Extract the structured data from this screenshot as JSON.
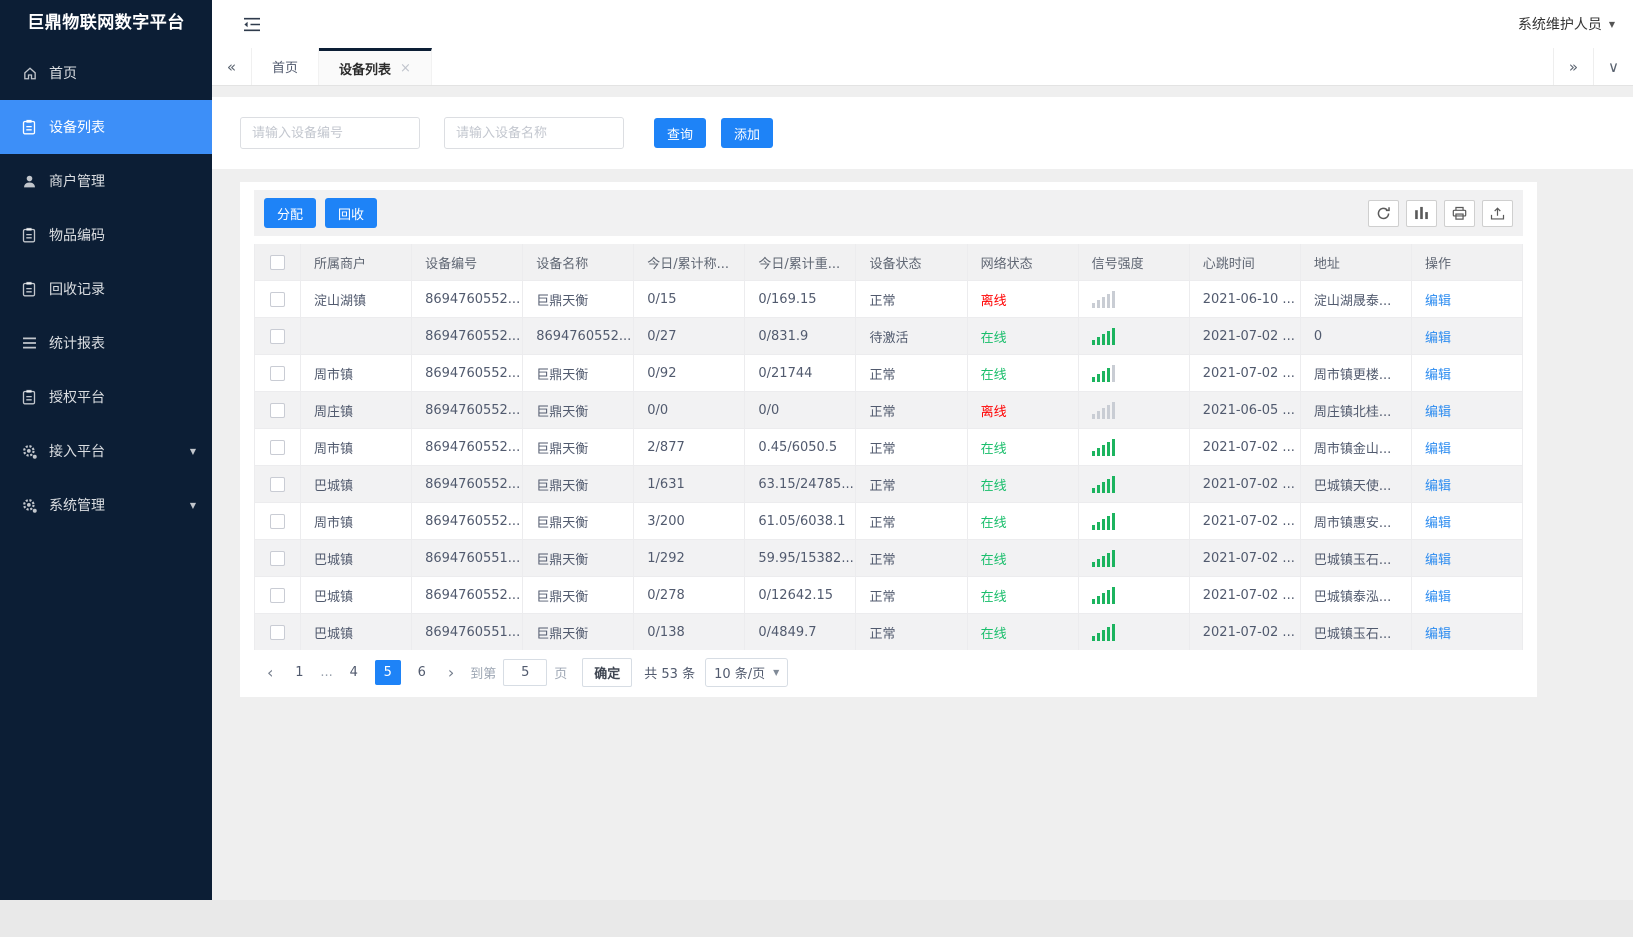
{
  "app": {
    "title": "巨鼎物联网数字平台",
    "user_name": "系统维护人员"
  },
  "sidebar": {
    "items": [
      {
        "label": "首页",
        "icon": "home-icon",
        "active": false,
        "caret": false
      },
      {
        "label": "设备列表",
        "icon": "device-list-icon",
        "active": true,
        "caret": false
      },
      {
        "label": "商户管理",
        "icon": "merchant-icon",
        "active": false,
        "caret": false
      },
      {
        "label": "物品编码",
        "icon": "item-code-icon",
        "active": false,
        "caret": false
      },
      {
        "label": "回收记录",
        "icon": "recycle-record-icon",
        "active": false,
        "caret": false
      },
      {
        "label": "统计报表",
        "icon": "report-icon",
        "active": false,
        "caret": false
      },
      {
        "label": "授权平台",
        "icon": "auth-platform-icon",
        "active": false,
        "caret": false
      },
      {
        "label": "接入平台",
        "icon": "access-platform-icon",
        "active": false,
        "caret": true
      },
      {
        "label": "系统管理",
        "icon": "system-manage-icon",
        "active": false,
        "caret": true
      }
    ]
  },
  "tabbar": {
    "tabs": [
      {
        "label": "首页",
        "active": false,
        "closable": false
      },
      {
        "label": "设备列表",
        "active": true,
        "closable": true
      }
    ]
  },
  "search": {
    "device_no_placeholder": "请输入设备编号",
    "device_name_placeholder": "请输入设备名称",
    "query_label": "查询",
    "add_label": "添加"
  },
  "toolbar": {
    "assign_label": "分配",
    "recycle_label": "回收",
    "icons": [
      "refresh-icon",
      "columns-icon",
      "print-icon",
      "export-icon"
    ]
  },
  "table": {
    "columns": [
      "所属商户",
      "设备编号",
      "设备名称",
      "今日/累计称...",
      "今日/累计重...",
      "设备状态",
      "网络状态",
      "信号强度",
      "心跳时间",
      "地址",
      "操作"
    ],
    "edit_label": "编辑",
    "rows": [
      {
        "merchant": "淀山湖镇",
        "device_no": "8694760552...",
        "device_name": "巨鼎天衡",
        "today_count": "0/15",
        "today_weight": "0/169.15",
        "device_status": "正常",
        "network_status": "离线",
        "online": false,
        "signal": 0,
        "heartbeat": "2021-06-10 ...",
        "address": "淀山湖晟泰..."
      },
      {
        "merchant": "",
        "device_no": "8694760552...",
        "device_name": "8694760552...",
        "today_count": "0/27",
        "today_weight": "0/831.9",
        "device_status": "待激活",
        "network_status": "在线",
        "online": true,
        "signal": 5,
        "heartbeat": "2021-07-02 ...",
        "address": "0"
      },
      {
        "merchant": "周市镇",
        "device_no": "8694760552...",
        "device_name": "巨鼎天衡",
        "today_count": "0/92",
        "today_weight": "0/21744",
        "device_status": "正常",
        "network_status": "在线",
        "online": true,
        "signal": 4,
        "heartbeat": "2021-07-02 ...",
        "address": "周市镇更楼..."
      },
      {
        "merchant": "周庄镇",
        "device_no": "8694760552...",
        "device_name": "巨鼎天衡",
        "today_count": "0/0",
        "today_weight": "0/0",
        "device_status": "正常",
        "network_status": "离线",
        "online": false,
        "signal": 0,
        "heartbeat": "2021-06-05 ...",
        "address": "周庄镇北桂..."
      },
      {
        "merchant": "周市镇",
        "device_no": "8694760552...",
        "device_name": "巨鼎天衡",
        "today_count": "2/877",
        "today_weight": "0.45/6050.5",
        "device_status": "正常",
        "network_status": "在线",
        "online": true,
        "signal": 5,
        "heartbeat": "2021-07-02 ...",
        "address": "周市镇金山..."
      },
      {
        "merchant": "巴城镇",
        "device_no": "8694760552...",
        "device_name": "巨鼎天衡",
        "today_count": "1/631",
        "today_weight": "63.15/24785...",
        "device_status": "正常",
        "network_status": "在线",
        "online": true,
        "signal": 5,
        "heartbeat": "2021-07-02 ...",
        "address": "巴城镇天使..."
      },
      {
        "merchant": "周市镇",
        "device_no": "8694760552...",
        "device_name": "巨鼎天衡",
        "today_count": "3/200",
        "today_weight": "61.05/6038.1",
        "device_status": "正常",
        "network_status": "在线",
        "online": true,
        "signal": 5,
        "heartbeat": "2021-07-02 ...",
        "address": "周市镇惠安..."
      },
      {
        "merchant": "巴城镇",
        "device_no": "8694760551...",
        "device_name": "巨鼎天衡",
        "today_count": "1/292",
        "today_weight": "59.95/15382...",
        "device_status": "正常",
        "network_status": "在线",
        "online": true,
        "signal": 5,
        "heartbeat": "2021-07-02 ...",
        "address": "巴城镇玉石..."
      },
      {
        "merchant": "巴城镇",
        "device_no": "8694760552...",
        "device_name": "巨鼎天衡",
        "today_count": "0/278",
        "today_weight": "0/12642.15",
        "device_status": "正常",
        "network_status": "在线",
        "online": true,
        "signal": 5,
        "heartbeat": "2021-07-02 ...",
        "address": "巴城镇泰泓..."
      },
      {
        "merchant": "巴城镇",
        "device_no": "8694760551...",
        "device_name": "巨鼎天衡",
        "today_count": "0/138",
        "today_weight": "0/4849.7",
        "device_status": "正常",
        "network_status": "在线",
        "online": true,
        "signal": 5,
        "heartbeat": "2021-07-02 ...",
        "address": "巴城镇玉石..."
      }
    ]
  },
  "pagination": {
    "pages": [
      "1",
      "...",
      "4",
      "5",
      "6"
    ],
    "active_page": "5",
    "goto_label": "到第",
    "goto_value": "5",
    "page_unit_label": "页",
    "confirm_label": "确定",
    "total_label": "共 53 条",
    "page_size_label": "10 条/页"
  },
  "colors": {
    "sidebar_bg": "#0c1e35",
    "sidebar_active": "#3d8ff8",
    "primary": "#1e83f7",
    "online_green": "#19be6b",
    "offline_red": "#ff0000",
    "link_blue": "#2d8cf0"
  }
}
